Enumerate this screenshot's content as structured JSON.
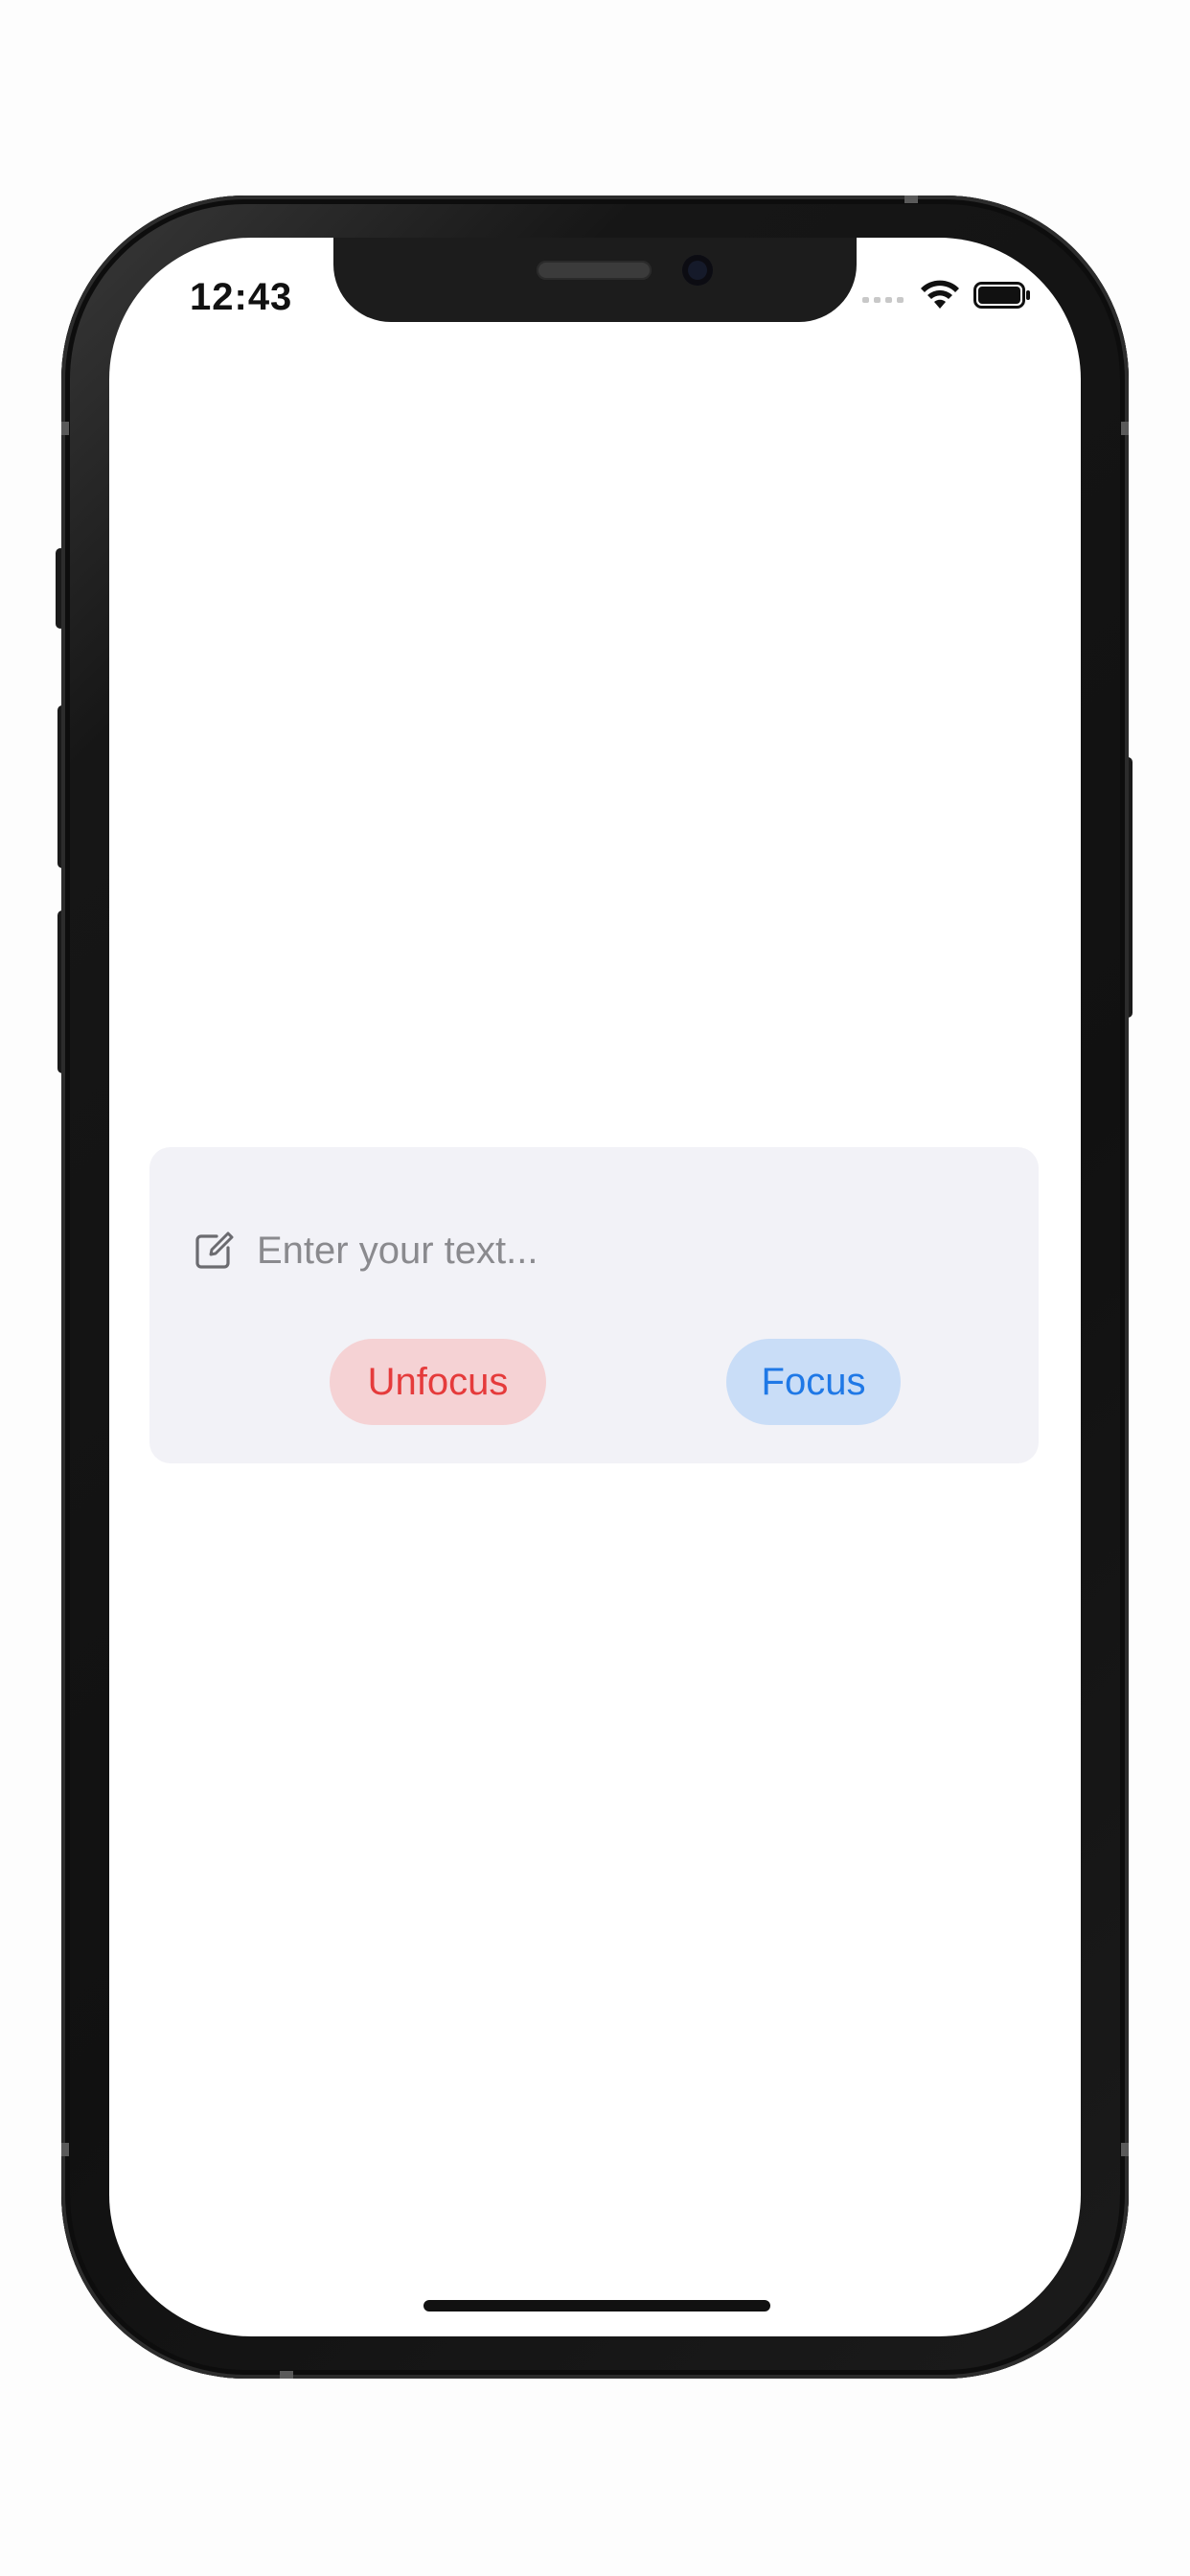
{
  "status_bar": {
    "time": "12:43"
  },
  "text_field": {
    "placeholder": "Enter your text...",
    "value": "",
    "icon": "compose-icon"
  },
  "buttons": {
    "unfocus_label": "Unfocus",
    "focus_label": "Focus"
  },
  "colors": {
    "card_background": "#f2f2f7",
    "unfocus_text": "#e53b3b",
    "unfocus_background": "#f5d2d4",
    "focus_text": "#1f78e6",
    "focus_background": "#c9ddf7",
    "placeholder_text": "#8a8a8e"
  }
}
